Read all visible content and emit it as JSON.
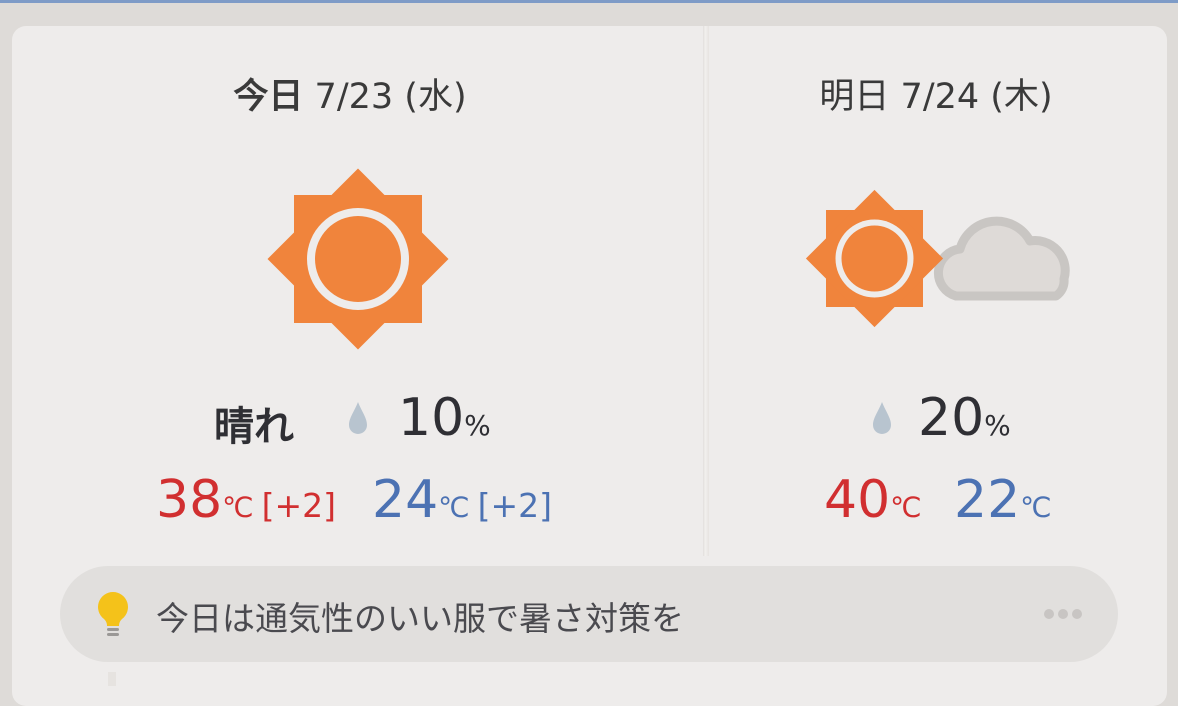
{
  "today": {
    "label": "今日",
    "date": "7/23",
    "weekday": "(水)",
    "icon": "sun-icon",
    "condition": "晴れ",
    "precip": "10",
    "precip_unit": "%",
    "high": "38",
    "high_unit": "℃",
    "high_diff": "[+2]",
    "low": "24",
    "low_unit": "℃",
    "low_diff": "[+2]"
  },
  "tomorrow": {
    "label": "明日",
    "date": "7/24",
    "weekday": "(木)",
    "icon": "sun-cloud-icon",
    "precip": "20",
    "precip_unit": "%",
    "high": "40",
    "high_unit": "℃",
    "low": "22",
    "low_unit": "℃"
  },
  "tip": {
    "icon": "lightbulb-icon",
    "text": "今日は通気性のいい服で暑さ対策を"
  },
  "colors": {
    "sun": "#f0843c",
    "high_temp": "#d12f30",
    "low_temp": "#4c72b3",
    "cloud": "#d8d5d2",
    "bulb": "#f4c21a"
  }
}
